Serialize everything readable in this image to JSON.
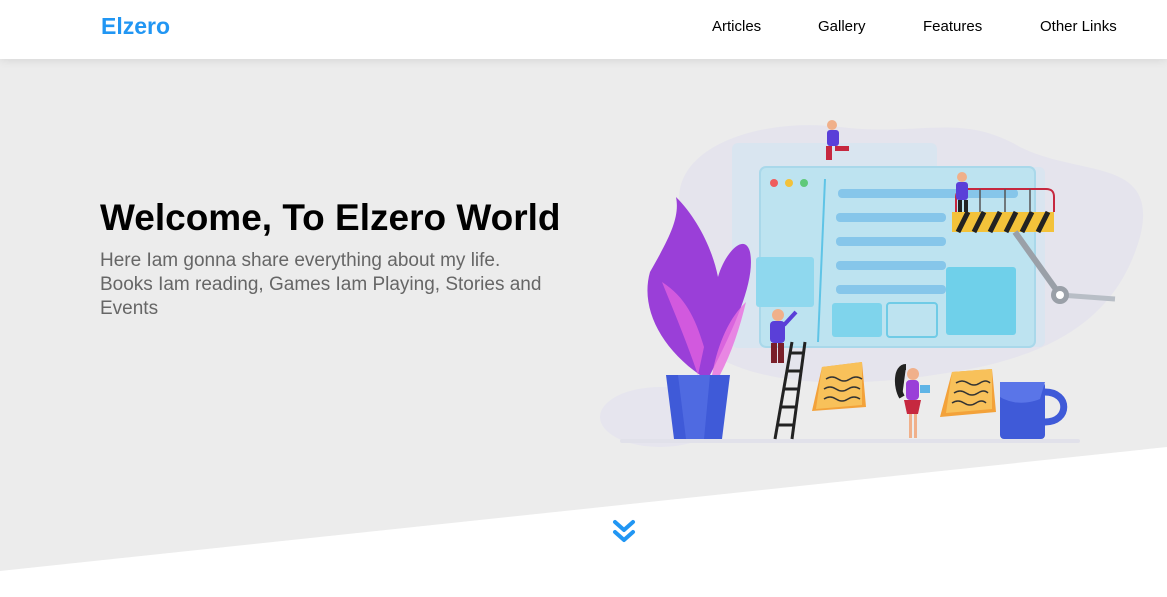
{
  "header": {
    "logo": "Elzero",
    "nav": {
      "articles": "Articles",
      "gallery": "Gallery",
      "features": "Features",
      "other_links": "Other Links"
    }
  },
  "landing": {
    "title": "Welcome, To Elzero World",
    "description": "Here Iam gonna share everything about my life. Books Iam reading, Games Iam Playing, Stories and Events"
  },
  "colors": {
    "accent": "#2196f3",
    "landing_bg": "#ececec",
    "text_muted": "#666666"
  },
  "icons": {
    "scroll_down": "double-chevron-down-icon"
  }
}
